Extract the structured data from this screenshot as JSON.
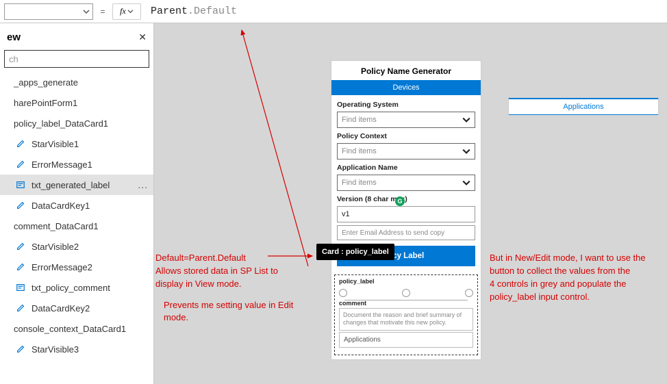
{
  "formula_bar": {
    "fx": "fx",
    "eq": "=",
    "prefix": "Parent",
    "suffix": ".Default"
  },
  "tree": {
    "title": "ew",
    "close": "✕",
    "search_placeholder": "ch",
    "items": [
      {
        "label": "_apps_generate",
        "indent": 1,
        "kind": "chev"
      },
      {
        "label": "harePointForm1",
        "indent": 1,
        "kind": "chev"
      },
      {
        "label": "policy_label_DataCard1",
        "indent": 1,
        "kind": "chev"
      },
      {
        "label": "StarVisible1",
        "indent": 2,
        "kind": "pencil"
      },
      {
        "label": "ErrorMessage1",
        "indent": 2,
        "kind": "pencil"
      },
      {
        "label": "txt_generated_label",
        "indent": 2,
        "kind": "text",
        "selected": true,
        "dots": "..."
      },
      {
        "label": "DataCardKey1",
        "indent": 2,
        "kind": "pencil"
      },
      {
        "label": "comment_DataCard1",
        "indent": 1,
        "kind": "chev"
      },
      {
        "label": "StarVisible2",
        "indent": 2,
        "kind": "pencil"
      },
      {
        "label": "ErrorMessage2",
        "indent": 2,
        "kind": "pencil"
      },
      {
        "label": "txt_policy_comment",
        "indent": 2,
        "kind": "text"
      },
      {
        "label": "DataCardKey2",
        "indent": 2,
        "kind": "pencil"
      },
      {
        "label": "console_context_DataCard1",
        "indent": 1,
        "kind": "chev"
      },
      {
        "label": "StarVisible3",
        "indent": 2,
        "kind": "pencil"
      }
    ]
  },
  "app": {
    "title": "Policy Name Generator",
    "tab_applications": "Applications",
    "tab_devices": "Devices",
    "os_label": "Operating System",
    "find_items": "Find items",
    "policy_context_label": "Policy Context",
    "appname_label": "Application Name",
    "version_label": "Version (8 char max)",
    "version_value": "v1",
    "email_placeholder": "Enter Email Address to send copy",
    "gen_button_visible": "licy Label",
    "tooltip": "Card : policy_label",
    "policy_label_lbl": "policy_label",
    "comment_lbl": "comment",
    "comment_placeholder": "Document the reason and brief summary of changes that motivate this new policy.",
    "apps_row": "Applications"
  },
  "anno": {
    "left1": "Default=Parent.Default",
    "left2": "Allows stored data in SP List to",
    "left3": "display in View mode.",
    "left4": "Prevents me setting value in Edit",
    "left5": "mode.",
    "right1": "But in New/Edit mode, I want to use the",
    "right2": "button to collect the values from the",
    "right3": "4 controls in grey and populate the",
    "right4": "policy_label input control."
  },
  "green_badge": "G"
}
